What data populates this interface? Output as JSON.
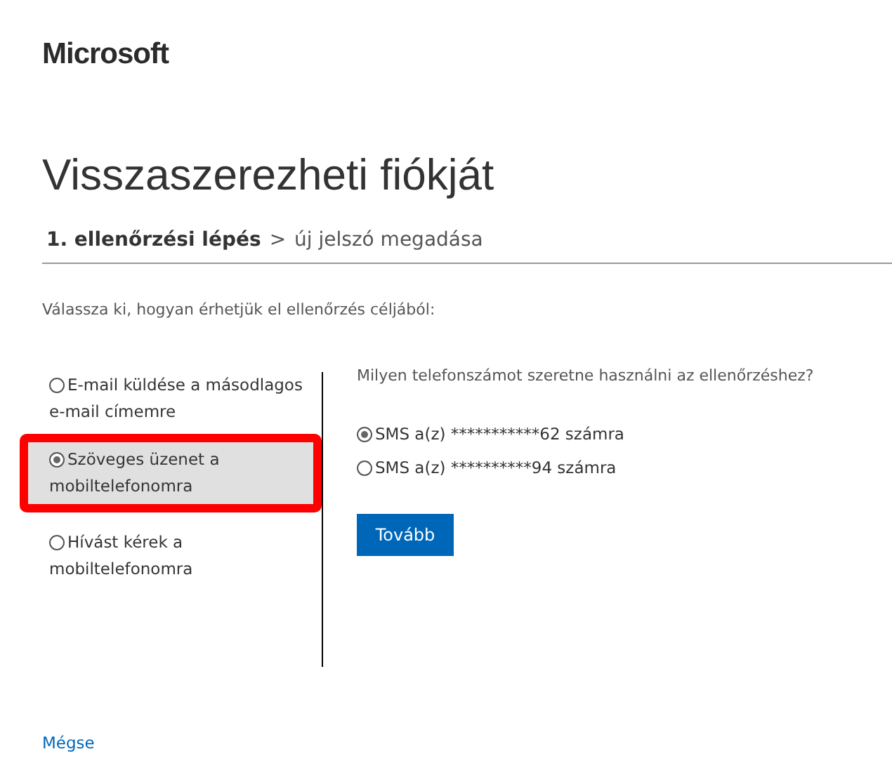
{
  "brand": "Microsoft",
  "title": "Visszaszerezheti fiókját",
  "steps": [
    {
      "label": "1. ellenőrzési lépés",
      "selected": true
    },
    {
      "label": "új jelszó megadása",
      "selected": false
    }
  ],
  "step_separator": ">",
  "instruction": "Válassza ki, hogyan érhetjük el ellenőrzés céljából:",
  "methods": [
    {
      "label": "E-mail küldése a másodlagos e-mail címemre",
      "selected": false,
      "highlighted": false
    },
    {
      "label": "Szöveges üzenet a mobiltelefonomra",
      "selected": true,
      "highlighted": true
    },
    {
      "label": "Hívást kérek a mobiltelefonomra",
      "selected": false,
      "highlighted": false
    }
  ],
  "question": "Milyen telefonszámot szeretne használni az ellenőrzéshez?",
  "phones": [
    {
      "label": "SMS a(z) ***********62 számra",
      "selected": true
    },
    {
      "label": "SMS a(z) **********94 számra",
      "selected": false
    }
  ],
  "next_button": "Tovább",
  "cancel_link": "Mégse"
}
